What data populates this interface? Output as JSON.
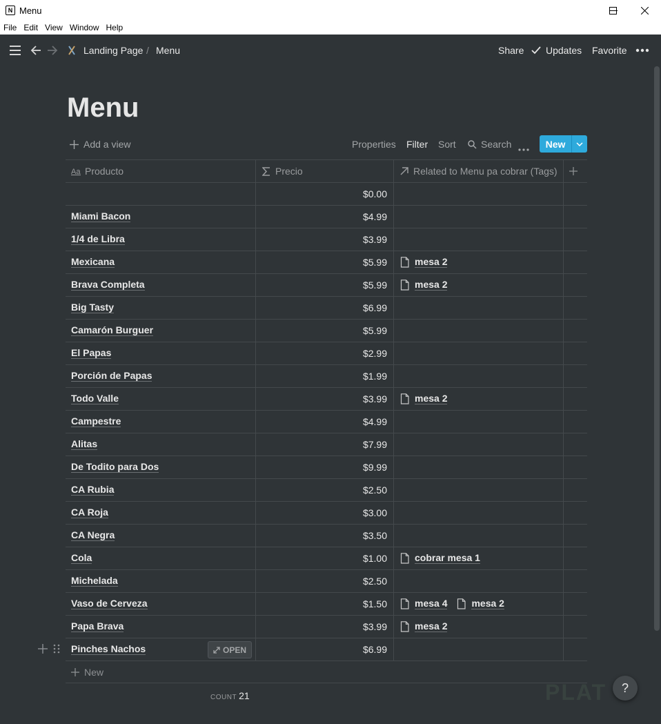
{
  "window": {
    "title": "Menu",
    "menu": [
      "File",
      "Edit",
      "View",
      "Window",
      "Help"
    ]
  },
  "topbar": {
    "breadcrumb": [
      "Landing Page",
      "Menu"
    ],
    "breadcrumb_sep": "/",
    "share": "Share",
    "updates": "Updates",
    "favorite": "Favorite"
  },
  "page": {
    "title": "Menu"
  },
  "view_bar": {
    "add_view": "Add a view",
    "properties": "Properties",
    "filter": "Filter",
    "sort": "Sort",
    "search": "Search",
    "new": "New"
  },
  "table": {
    "columns": [
      "Producto",
      "Precio",
      "Related to Menu pa cobrar (Tags)"
    ],
    "rows": [
      {
        "name": "",
        "price": "$0.00",
        "tags": []
      },
      {
        "name": "Miami Bacon",
        "price": "$4.99",
        "tags": []
      },
      {
        "name": "1/4 de Libra",
        "price": "$3.99",
        "tags": []
      },
      {
        "name": "Mexicana",
        "price": "$5.99",
        "tags": [
          "mesa 2"
        ]
      },
      {
        "name": "Brava Completa",
        "price": "$5.99",
        "tags": [
          "mesa 2"
        ]
      },
      {
        "name": "Big Tasty",
        "price": "$6.99",
        "tags": []
      },
      {
        "name": "Camarón Burguer",
        "price": "$5.99",
        "tags": []
      },
      {
        "name": "El Papas",
        "price": "$2.99",
        "tags": []
      },
      {
        "name": "Porción de Papas",
        "price": "$1.99",
        "tags": []
      },
      {
        "name": "Todo Valle",
        "price": "$3.99",
        "tags": [
          "mesa 2"
        ]
      },
      {
        "name": "Campestre",
        "price": "$4.99",
        "tags": []
      },
      {
        "name": "Alitas",
        "price": "$7.99",
        "tags": []
      },
      {
        "name": "De Todito para Dos",
        "price": "$9.99",
        "tags": []
      },
      {
        "name": "CA Rubia",
        "price": "$2.50",
        "tags": []
      },
      {
        "name": "CA Roja",
        "price": "$3.00",
        "tags": []
      },
      {
        "name": "CA Negra",
        "price": "$3.50",
        "tags": []
      },
      {
        "name": "Cola",
        "price": "$1.00",
        "tags": [
          "cobrar mesa 1"
        ]
      },
      {
        "name": "Michelada",
        "price": "$2.50",
        "tags": []
      },
      {
        "name": "Vaso de Cerveza",
        "price": "$1.50",
        "tags": [
          "mesa 4",
          "mesa 2"
        ]
      },
      {
        "name": "Papa Brava",
        "price": "$3.99",
        "tags": [
          "mesa 2"
        ]
      },
      {
        "name": "Pinches Nachos",
        "price": "$6.99",
        "tags": [],
        "hovered": true
      }
    ],
    "open_label": "OPEN",
    "add_row": "New",
    "count_label": "COUNT",
    "count_value": "21"
  },
  "help": "?",
  "watermark": "PLAT"
}
